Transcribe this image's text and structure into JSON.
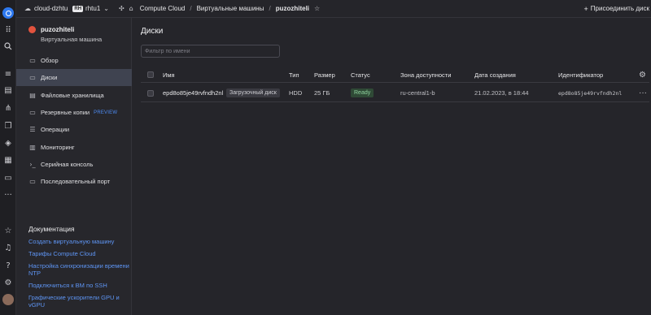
{
  "topbar": {
    "cloud": "cloud-dzhtu",
    "folder_badge": "RH",
    "folder": "rhtu1",
    "breadcrumb": [
      "Compute Cloud",
      "Виртуальные машины",
      "puzozhiteli"
    ],
    "join_label": "Присоединить диск"
  },
  "vm": {
    "name": "puzozhiteli",
    "type": "Виртуальная машина"
  },
  "nav": [
    {
      "label": "Обзор",
      "icon": "overview-icon"
    },
    {
      "label": "Диски",
      "icon": "disk-icon"
    },
    {
      "label": "Файловые хранилища",
      "icon": "storage-icon"
    },
    {
      "label": "Резервные копии",
      "icon": "backup-icon",
      "badge": "PREVIEW"
    },
    {
      "label": "Операции",
      "icon": "list-icon"
    },
    {
      "label": "Мониторинг",
      "icon": "chart-icon"
    },
    {
      "label": "Серийная консоль",
      "icon": "terminal-icon"
    },
    {
      "label": "Последовательный порт",
      "icon": "port-icon"
    }
  ],
  "docs": {
    "title": "Документация",
    "links": [
      "Создать виртуальную машину",
      "Тарифы Compute Cloud",
      "Настройка синхронизации времени NTP",
      "Подключиться к ВМ по SSH",
      "Графические ускорители GPU и vGPU"
    ]
  },
  "main": {
    "title": "Диски",
    "filter_placeholder": "Фильтр по имени",
    "columns": [
      "Имя",
      "Тип",
      "Размер",
      "Статус",
      "Зона доступности",
      "Дата создания",
      "Идентификатор"
    ],
    "rows": [
      {
        "name": "epd8o85je49rvfndh2nl",
        "tag": "Загрузочный диск",
        "type": "HDD",
        "size": "25 ГБ",
        "status": "Ready",
        "zone": "ru-central1-b",
        "created": "21.02.2023, в 18:44",
        "id": "epd8o85je49rvfndh2nl"
      }
    ]
  },
  "colors": {
    "accent": "#2e79f0",
    "link": "#5e95f4",
    "status_ready": "#8fd19e",
    "active_nav": "#3f4350"
  }
}
